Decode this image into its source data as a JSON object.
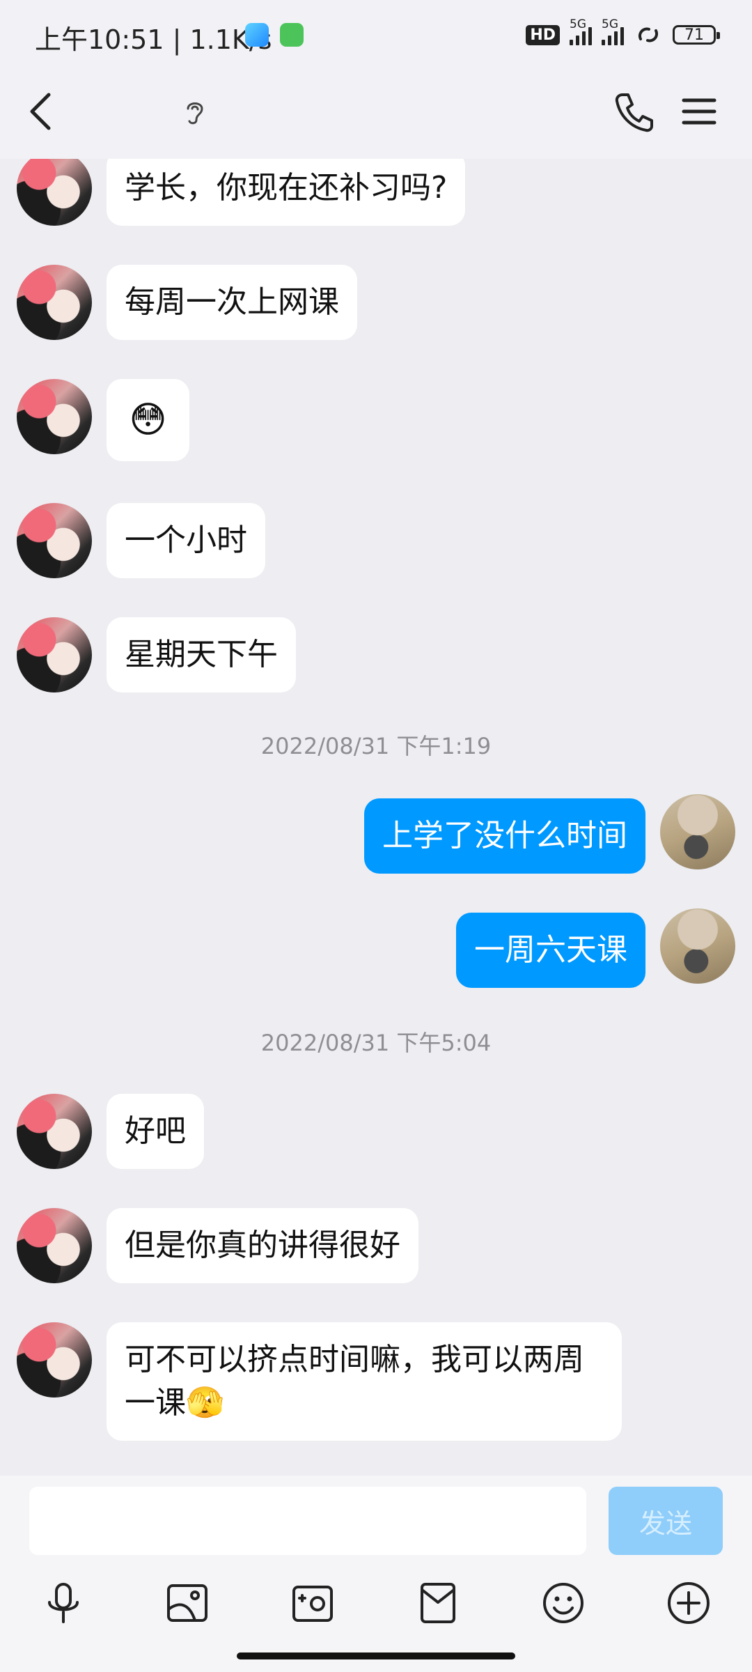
{
  "status_bar": {
    "time": "上午10:51 | 1.1K/s",
    "hd": "HD",
    "net1": "5G",
    "net2": "5G",
    "battery": "71"
  },
  "header": {
    "title": ""
  },
  "messages": [
    {
      "side": "friend",
      "text": "学长，你现在还补习吗?"
    },
    {
      "side": "friend",
      "text": "每周一次上网课"
    },
    {
      "side": "friend",
      "text": "😳",
      "emoji": true
    },
    {
      "side": "friend",
      "text": "一个小时"
    },
    {
      "side": "friend",
      "text": "星期天下午"
    },
    {
      "timestamp": "2022/08/31 下午1:19"
    },
    {
      "side": "self",
      "text": "上学了没什么时间"
    },
    {
      "side": "self",
      "text": "一周六天课"
    },
    {
      "timestamp": "2022/08/31 下午5:04"
    },
    {
      "side": "friend",
      "text": "好吧"
    },
    {
      "side": "friend",
      "text": "但是你真的讲得很好"
    },
    {
      "side": "friend",
      "text": "可不可以挤点时间嘛，我可以两周一课🫣"
    }
  ],
  "input": {
    "value": "",
    "send_label": "发送"
  },
  "toolbar": {
    "items": [
      "microphone-icon",
      "image-icon",
      "camera-icon",
      "red-packet-icon",
      "emoji-icon",
      "plus-icon"
    ]
  },
  "colors": {
    "accent": "#0099ff",
    "background": "#ededf2",
    "send_disabled": "#8fcdfa"
  }
}
